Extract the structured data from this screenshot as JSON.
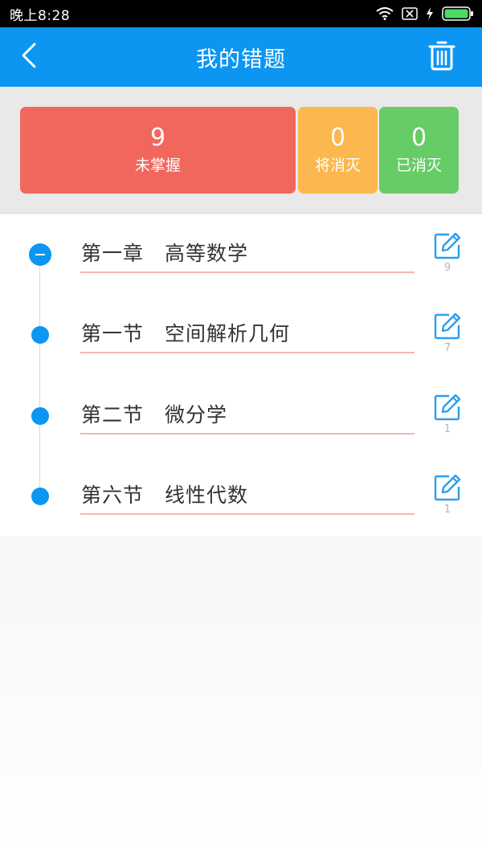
{
  "status_bar": {
    "time": "晚上8:28",
    "icons": [
      "wifi-icon",
      "sim-off-icon",
      "charging-icon",
      "battery-icon"
    ]
  },
  "header": {
    "title": "我的错题",
    "back_icon": "chevron-left-icon",
    "delete_icon": "trash-icon",
    "background": "#0c96f2"
  },
  "stats": [
    {
      "value": "9",
      "label": "未掌握",
      "color": "#f2675d"
    },
    {
      "value": "0",
      "label": "将消灭",
      "color": "#fcb74e"
    },
    {
      "value": "0",
      "label": "已消灭",
      "color": "#66cc66"
    }
  ],
  "chapters": [
    {
      "title": "第一章　高等数学",
      "count": "9",
      "node": "collapse-minus"
    },
    {
      "title": "第一节　空间解析几何",
      "count": "7",
      "node": "dot"
    },
    {
      "title": "第二节　微分学",
      "count": "1",
      "node": "dot"
    },
    {
      "title": "第六节　线性代数",
      "count": "1",
      "node": "dot"
    }
  ],
  "colors": {
    "accent": "#0c96f2",
    "underline": "#f6b7b1",
    "count_text": "#b5b5b5"
  }
}
